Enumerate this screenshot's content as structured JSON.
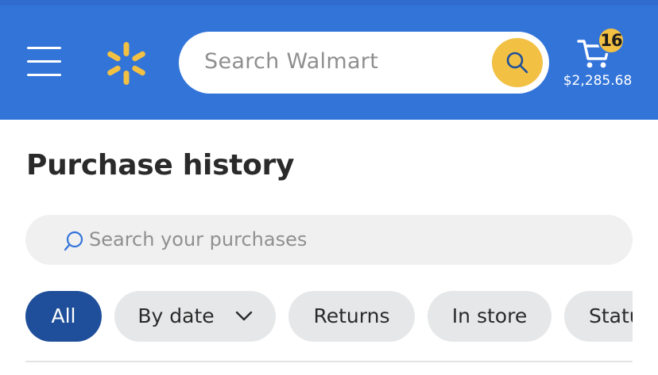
{
  "header": {
    "search_placeholder": "Search Walmart",
    "cart": {
      "count": "16",
      "total": "$2,285.68"
    },
    "colors": {
      "brand_blue": "#3374d9",
      "spark_yellow": "#f2c043"
    }
  },
  "page": {
    "title": "Purchase history",
    "search_placeholder": "Search your purchases"
  },
  "filters": [
    {
      "label": "All",
      "active": true
    },
    {
      "label": "By date",
      "active": false,
      "has_dropdown": true
    },
    {
      "label": "Returns",
      "active": false
    },
    {
      "label": "In store",
      "active": false
    },
    {
      "label": "Status",
      "active": false
    }
  ]
}
